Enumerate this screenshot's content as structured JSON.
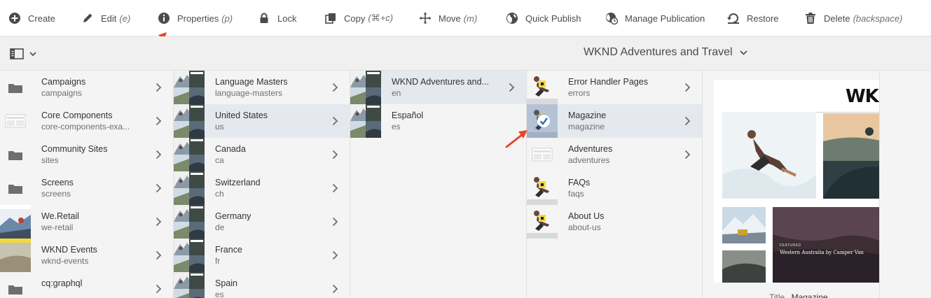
{
  "toolbar": {
    "create": "Create",
    "edit": "Edit",
    "edit_shortcut": "(e)",
    "properties": "Properties",
    "properties_shortcut": "(p)",
    "lock": "Lock",
    "copy": "Copy",
    "copy_shortcut": "(⌘+c)",
    "move": "Move",
    "move_shortcut": "(m)",
    "quick_publish": "Quick Publish",
    "manage_publication": "Manage Publication",
    "restore": "Restore",
    "delete": "Delete",
    "delete_shortcut": "(backspace)"
  },
  "header": {
    "title": "WKND Adventures and Travel"
  },
  "columns": [
    {
      "items": [
        {
          "title": "Campaigns",
          "name": "campaigns",
          "thumb": "folder"
        },
        {
          "title": "Core Components",
          "name": "core-components-exa...",
          "thumb": "site"
        },
        {
          "title": "Community Sites",
          "name": "sites",
          "thumb": "folder"
        },
        {
          "title": "Screens",
          "name": "screens",
          "thumb": "folder"
        },
        {
          "title": "We.Retail",
          "name": "we-retail",
          "thumb": "retail"
        },
        {
          "title": "WKND Events",
          "name": "wknd-events",
          "thumb": "events"
        },
        {
          "title": "cq:graphql",
          "name": "",
          "thumb": "folder"
        }
      ]
    },
    {
      "items": [
        {
          "title": "Language Masters",
          "name": "language-masters"
        },
        {
          "title": "United States",
          "name": "us",
          "selected": true
        },
        {
          "title": "Canada",
          "name": "ca"
        },
        {
          "title": "Switzerland",
          "name": "ch"
        },
        {
          "title": "Germany",
          "name": "de"
        },
        {
          "title": "France",
          "name": "fr"
        },
        {
          "title": "Spain",
          "name": "es"
        }
      ]
    },
    {
      "items": [
        {
          "title": "WKND Adventures and...",
          "name": "en",
          "selected": true
        },
        {
          "title": "Español",
          "name": "es",
          "no_chevron": true
        }
      ]
    },
    {
      "items": [
        {
          "title": "Error Handler Pages",
          "name": "errors",
          "thumb": "skater"
        },
        {
          "title": "Magazine",
          "name": "magazine",
          "selected": true,
          "checked": true,
          "thumb": "skater"
        },
        {
          "title": "Adventures",
          "name": "adventures",
          "thumb": "site"
        },
        {
          "title": "FAQs",
          "name": "faqs",
          "no_chevron": true,
          "thumb": "skater"
        },
        {
          "title": "About Us",
          "name": "about-us",
          "no_chevron": true,
          "thumb": "skater"
        }
      ]
    }
  ],
  "preview": {
    "logo": "WKND",
    "featured_label": "FEATURED",
    "featured_title": "Western Australia by Camper Van",
    "bottom_key": "Title",
    "bottom_value": "Magazine"
  },
  "colors": {
    "selected_row": "#e5e9ef",
    "arrow": "#e8452c"
  }
}
